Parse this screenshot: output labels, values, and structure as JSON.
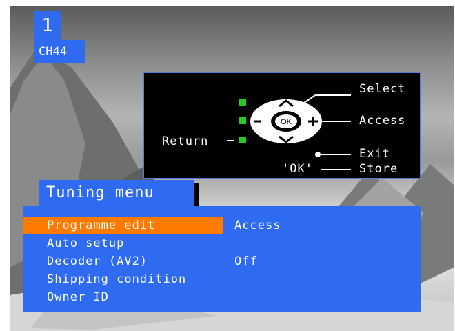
{
  "channel": {
    "number": "1",
    "name": "CH44"
  },
  "help": {
    "select": "Select",
    "access": "Access",
    "return": "Return",
    "exit": "Exit",
    "ok_label": "'OK'",
    "store": "Store",
    "ok_button": "OK"
  },
  "menu": {
    "title": "Tuning menu",
    "items": [
      {
        "label": "Programme edit",
        "value": "Access",
        "selected": true
      },
      {
        "label": "Auto setup",
        "value": ""
      },
      {
        "label": "Decoder (AV2)",
        "value": "Off"
      },
      {
        "label": "Shipping condition",
        "value": ""
      },
      {
        "label": "Owner ID",
        "value": ""
      }
    ]
  },
  "colors": {
    "menu_bg": "#2f6bf0",
    "highlight": "#ff7b00",
    "indicator": "#22cc22",
    "panel_bg": "#000000"
  }
}
